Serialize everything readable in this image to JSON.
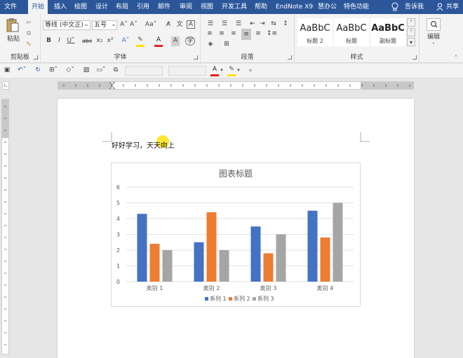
{
  "tabs": [
    "文件",
    "开始",
    "插入",
    "绘图",
    "设计",
    "布局",
    "引用",
    "邮件",
    "审阅",
    "视图",
    "开发工具",
    "帮助",
    "EndNote X9",
    "慧办公",
    "特色功能"
  ],
  "tell_me": "告诉我",
  "share": "共享",
  "clipboard": {
    "paste": "粘贴",
    "label": "剪贴板"
  },
  "font": {
    "name": "等线 (中文正)",
    "size": "五号",
    "label": "字体"
  },
  "paragraph": {
    "label": "段落"
  },
  "styles": {
    "items": [
      {
        "sample": "AaBbC",
        "name": "标题 2"
      },
      {
        "sample": "AaBbC",
        "name": "标题"
      },
      {
        "sample": "AaBbC",
        "name": "副标题"
      }
    ],
    "label": "样式"
  },
  "editing": {
    "label": "编辑"
  },
  "document": {
    "text": "好好学习，天天向上"
  },
  "colors": {
    "accent": "#2b579a",
    "highlight": "#ffe000",
    "font_color": "#e8211f"
  },
  "chart_data": {
    "type": "bar",
    "title": "图表标题",
    "categories": [
      "类别 1",
      "类别 2",
      "类别 3",
      "类别 4"
    ],
    "series": [
      {
        "name": "系列 1",
        "values": [
          4.3,
          2.5,
          3.5,
          4.5
        ],
        "color": "#4472c4"
      },
      {
        "name": "系列 2",
        "values": [
          2.4,
          4.4,
          1.8,
          2.8
        ],
        "color": "#ed7d31"
      },
      {
        "name": "系列 3",
        "values": [
          2,
          2,
          3,
          5
        ],
        "color": "#a5a5a5"
      }
    ],
    "ylim": [
      0,
      6
    ],
    "yticks": [
      0,
      1,
      2,
      3,
      4,
      5,
      6
    ],
    "grid": true,
    "legend": "bottom"
  }
}
